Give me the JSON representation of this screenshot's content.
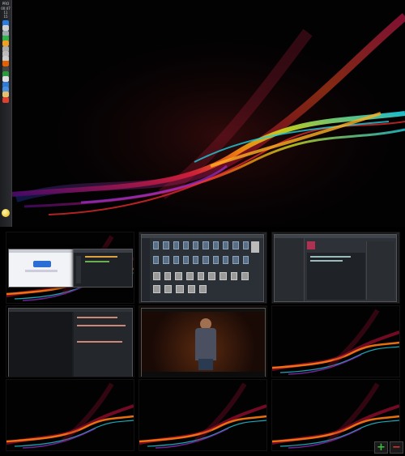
{
  "desktop": {
    "brand_colors": {
      "red": "#ff2030",
      "orange": "#ff8a10",
      "cyan": "#21d0e0",
      "purple": "#8a2bd0"
    },
    "dock": {
      "top_label": "PRO",
      "clock_lines": [
        "00:47",
        "11",
        "15"
      ],
      "icons": [
        {
          "name": "shield-icon",
          "color": "#2a7de1"
        },
        {
          "name": "chat-icon",
          "color": "#cfcfcf"
        },
        {
          "name": "network-icon",
          "color": "#9aa"
        },
        {
          "name": "update-icon",
          "color": "#2fb34a"
        },
        {
          "name": "battery-icon",
          "color": "#f0a020"
        },
        {
          "name": "printer-icon",
          "color": "#aaa"
        },
        {
          "name": "volume-icon",
          "color": "#bbb"
        },
        {
          "name": "audio-icon",
          "color": "#ccc"
        },
        {
          "name": "firefox-icon",
          "color": "#e66000"
        },
        {
          "name": "terminal-icon",
          "color": "#444"
        },
        {
          "name": "app-green-icon",
          "color": "#2c9a3a"
        },
        {
          "name": "document-icon",
          "color": "#ddd"
        },
        {
          "name": "browser-icon",
          "color": "#2e7bd6"
        },
        {
          "name": "chat-client-icon",
          "color": "#4a90e2"
        },
        {
          "name": "folder-icon",
          "color": "#e2c070"
        },
        {
          "name": "gmail-icon",
          "color": "#e04030"
        }
      ],
      "bottom_icon": "home-orb-icon"
    }
  },
  "workspaces": [
    {
      "name": "workspace-1",
      "content": "browser-and-terminal"
    },
    {
      "name": "workspace-2",
      "content": "file-manager"
    },
    {
      "name": "workspace-3",
      "content": "ide"
    },
    {
      "name": "workspace-4",
      "content": "code-editor"
    },
    {
      "name": "workspace-5",
      "content": "game"
    },
    {
      "name": "workspace-6",
      "content": "empty"
    },
    {
      "name": "workspace-7",
      "content": "empty"
    },
    {
      "name": "workspace-8",
      "content": "empty"
    },
    {
      "name": "workspace-9",
      "content": "empty"
    }
  ],
  "controls": {
    "add": "+",
    "remove": "−"
  }
}
